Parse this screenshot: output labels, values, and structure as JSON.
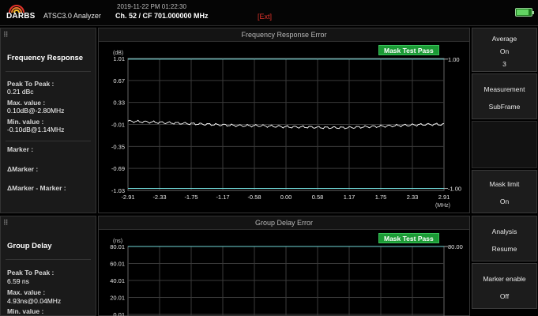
{
  "header": {
    "brand": "DARBS",
    "app_name": "ATSC3.0 Analyzer",
    "datetime": "2019-11-22 PM 01:22:30",
    "channel": "Ch. 52 / CF 701.000000 MHz",
    "ext": "[Ext]",
    "battery_level": 0.85
  },
  "colors": {
    "accent_green": "#1b9a35",
    "warning_red": "#e2332b",
    "trace": "#ffffff",
    "mask": "#6fd6d6"
  },
  "panels": {
    "frequency_response": {
      "title": "Frequency Response",
      "p2p_label": "Peak To Peak :",
      "p2p_value": "0.21 dBc",
      "max_label": "Max. value :",
      "max_value": "0.10dB@-2.80MHz",
      "min_label": "Min. value :",
      "min_value": "-0.10dB@1.14MHz",
      "marker_label": "Marker :",
      "dmarker_label": "ΔMarker :",
      "dmarker_minus_label": "ΔMarker - Marker :"
    },
    "group_delay": {
      "title": "Group Delay",
      "p2p_label": "Peak To Peak :",
      "p2p_value": "6.59 ns",
      "max_label": "Max. value  :",
      "max_value": "4.93ns@0.04MHz",
      "min_label": "Min. value  :"
    }
  },
  "buttons": [
    {
      "label": "Average",
      "value": "On",
      "extra": "3"
    },
    {
      "label": "Measurement",
      "value": "SubFrame"
    },
    {
      "label": "Mask limit",
      "value": "On"
    },
    {
      "label": "Analysis",
      "value": "Resume"
    },
    {
      "label": "Marker enable",
      "value": "Off"
    }
  ],
  "chart_data": [
    {
      "type": "line",
      "title": "Frequency Response Error",
      "badge": "Mask Test Pass",
      "ylabel": "(dB)",
      "xlabel": "(MHz)",
      "y_ticks": [
        "1.01",
        "0.67",
        "0.33",
        "-0.01",
        "-0.35",
        "-0.69",
        "-1.03"
      ],
      "x_ticks": [
        "-2.91",
        "-2.33",
        "-1.75",
        "-1.17",
        "-0.58",
        "0.00",
        "0.58",
        "1.17",
        "1.75",
        "2.33",
        "2.91"
      ],
      "right_ticks": [
        "1.00",
        "-1.00"
      ],
      "ylim": [
        -1.03,
        1.01
      ],
      "xlim": [
        -2.91,
        2.91
      ],
      "mask_upper": 1.0,
      "mask_lower": -1.0,
      "grid": true,
      "series": [
        {
          "x": [
            -2.91,
            -2.6,
            -2.3,
            -2.0,
            -1.7,
            -1.4,
            -1.1,
            -0.8,
            -0.5,
            -0.2,
            0.1,
            0.4,
            0.7,
            1.0,
            1.14,
            1.4,
            1.7,
            2.0,
            2.3,
            2.6,
            2.91
          ],
          "values": [
            0.04,
            0.03,
            0.02,
            0.01,
            0.0,
            -0.01,
            -0.02,
            -0.03,
            -0.03,
            -0.04,
            -0.05,
            -0.05,
            -0.06,
            -0.06,
            -0.06,
            -0.05,
            -0.04,
            -0.03,
            -0.02,
            -0.01,
            -0.01
          ]
        }
      ],
      "ripple": 0.015
    },
    {
      "type": "line",
      "title": "Group Delay Error",
      "badge": "Mask Test Pass",
      "ylabel": "(ns)",
      "y_ticks": [
        "80.01",
        "60.01",
        "40.01",
        "20.01",
        "0.01"
      ],
      "right_ticks": [
        "80.00"
      ],
      "ylim": [
        0.01,
        80.01
      ],
      "xlim": [
        -2.91,
        2.91
      ],
      "mask_upper": 80.0,
      "grid": true,
      "series": [
        {
          "x": [
            -2.91,
            -2.0,
            -1.0,
            0.0,
            1.0,
            2.0,
            2.91
          ],
          "values": [
            1.2,
            1.0,
            0.9,
            1.1,
            0.8,
            1.0,
            0.9
          ]
        }
      ],
      "ripple": 0.8
    }
  ]
}
